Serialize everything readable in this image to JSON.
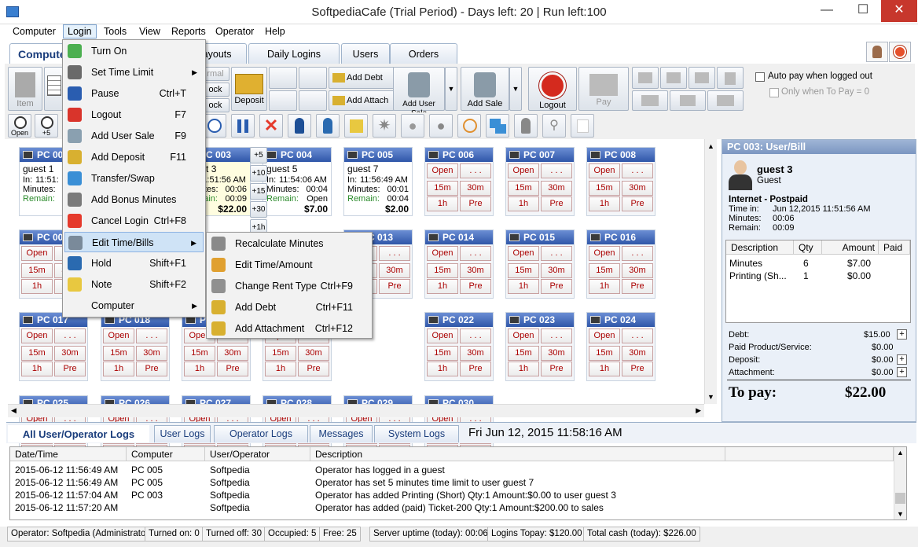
{
  "window": {
    "title": "SoftpediaCafe (Trial Period) - Days left: 20 | Run left:100",
    "minimize": "—",
    "maximize": "☐",
    "close": "✕"
  },
  "menubar": [
    "Computer",
    "Login",
    "Tools",
    "View",
    "Reports",
    "Operator",
    "Help"
  ],
  "main_tabs": [
    "Computers",
    "Debt/Payouts",
    "Daily Logins",
    "Users",
    "Orders"
  ],
  "toolbar": {
    "item": "Item",
    "deposit": "Deposit",
    "add_debt": "Add Debt",
    "add_attach": "Add Attach",
    "add_user_sale": "Add User Sale",
    "add_sale": "Add Sale",
    "logout": "Logout",
    "pay": "Pay",
    "auto_pay": "Auto pay when logged out",
    "only_when": "Only when To Pay = 0",
    "open": "Open",
    "plus5": "+5",
    "normal_partial": "rmal",
    "lock_partial": "ock"
  },
  "pcs": [
    {
      "name": "PC 001",
      "user": "guest 1",
      "in": "11:51:",
      "minutes": "",
      "remain": "",
      "amount": "$"
    },
    {
      "name": "PC 003",
      "user": "guest 3",
      "in": "11:51:56 AM",
      "minutes": "00:06",
      "remain": "00:09",
      "amount": "$22.00"
    },
    {
      "name": "PC 004",
      "user": "guest 5",
      "in": "11:54:06 AM",
      "minutes": "00:04",
      "remain": "Open",
      "amount": "$7.00"
    },
    {
      "name": "PC 005",
      "user": "guest 7",
      "in": "11:56:49 AM",
      "minutes": "00:01",
      "remain": "00:04",
      "amount": "$2.00"
    },
    {
      "name": "PC 006"
    },
    {
      "name": "PC 007"
    },
    {
      "name": "PC 008"
    },
    {
      "name": "PC 00"
    },
    {
      "name": "PC 013"
    },
    {
      "name": "PC 014"
    },
    {
      "name": "PC 015"
    },
    {
      "name": "PC 016"
    },
    {
      "name": "PC 017"
    },
    {
      "name": "PC 018"
    },
    {
      "name": "PC 0"
    },
    {
      "name": "PC 021"
    },
    {
      "name": "PC 022"
    },
    {
      "name": "PC 023"
    },
    {
      "name": "PC 024"
    },
    {
      "name": "PC 025"
    },
    {
      "name": "PC 026"
    },
    {
      "name": "PC 027"
    },
    {
      "name": "PC 028"
    },
    {
      "name": "PC 029"
    },
    {
      "name": "PC 030"
    }
  ],
  "pc_labels": {
    "in": "In:",
    "minutes": "Minutes:",
    "remain": "Remain:",
    "open": "Open",
    "dots": ". . .",
    "m15": "15m",
    "m30": "30m",
    "h1": "1h",
    "pre": "Pre"
  },
  "side_buttons": [
    "+5",
    "+10",
    "+15",
    "+30",
    "+1h"
  ],
  "right_panel": {
    "header": "PC 003: User/Bill",
    "user": "guest 3",
    "role": "Guest",
    "session": "Internet - Postpaid",
    "time_in_label": "Time in:",
    "time_in": "Jun 12,2015 11:51:56 AM",
    "minutes_label": "Minutes:",
    "minutes": "00:06",
    "remain_label": "Remain:",
    "remain": "00:09",
    "columns": [
      "Description",
      "Qty",
      "Amount",
      "Paid"
    ],
    "rows": [
      {
        "desc": "Minutes",
        "qty": "6",
        "amount": "$7.00"
      },
      {
        "desc": "Printing (Sh...",
        "qty": "1",
        "amount": "$0.00"
      }
    ],
    "debt_label": "Debt:",
    "debt": "$15.00",
    "paid_label": "Paid Product/Service:",
    "paid": "$0.00",
    "deposit_label": "Deposit:",
    "deposit": "$0.00",
    "attach_label": "Attachment:",
    "attach": "$0.00",
    "topay_label": "To pay:",
    "topay": "$22.00"
  },
  "log_tabs": [
    "All User/Operator Logs",
    "User Logs",
    "Operator Logs",
    "Messages",
    "System Logs"
  ],
  "datetime": "Fri Jun 12, 2015  11:58:16 AM",
  "log_columns": [
    "Date/Time",
    "Computer",
    "User/Operator",
    "Description"
  ],
  "logs": [
    {
      "time": "2015-06-12 11:56:49 AM",
      "pc": "PC 005",
      "user": "Softpedia",
      "desc": "Operator has logged in a guest"
    },
    {
      "time": "2015-06-12 11:56:49 AM",
      "pc": "PC 005",
      "user": "Softpedia",
      "desc": "Operator has set 5 minutes time limit to user guest 7"
    },
    {
      "time": "2015-06-12 11:57:04 AM",
      "pc": "PC 003",
      "user": "Softpedia",
      "desc": "Operator has added Printing (Short) Qty:1 Amount:$0.00 to user guest 3"
    },
    {
      "time": "2015-06-12 11:57:20 AM",
      "pc": "",
      "user": "Softpedia",
      "desc": "Operator has added (paid) Ticket-200 Qty:1 Amount:$200.00 to sales"
    }
  ],
  "status": [
    "Operator: Softpedia (Administrator)",
    "Turned on: 0",
    "Turned off: 30",
    "Occupied: 5",
    "Free: 25",
    "Server uptime (today): 00:06",
    "Logins Topay: $120.00",
    "Total cash (today): $226.00"
  ],
  "login_menu": [
    {
      "label": "Turn On",
      "sc": "",
      "sub": false,
      "color": "#4caf50"
    },
    {
      "label": "Set Time Limit",
      "sc": "",
      "sub": true,
      "color": "#6a6a6a"
    },
    {
      "label": "Pause",
      "sc": "Ctrl+T",
      "sub": false,
      "color": "#2a5db0"
    },
    {
      "label": "Logout",
      "sc": "F7",
      "sub": false,
      "color": "#d9342b"
    },
    {
      "label": "Add User Sale",
      "sc": "F9",
      "sub": false,
      "color": "#8aa0b0"
    },
    {
      "label": "Add Deposit",
      "sc": "F11",
      "sub": false,
      "color": "#d8b030"
    },
    {
      "label": "Transfer/Swap",
      "sc": "",
      "sub": false,
      "color": "#3a8fd6"
    },
    {
      "label": "Add Bonus Minutes",
      "sc": "",
      "sub": false,
      "color": "#7a7a7a"
    },
    {
      "label": "Cancel Login",
      "sc": "Ctrl+F8",
      "sub": false,
      "color": "#e53a2c"
    },
    {
      "label": "Edit Time/Bills",
      "sc": "",
      "sub": true,
      "color": "#7a8a9a"
    },
    {
      "label": "Hold",
      "sc": "Shift+F1",
      "sub": false,
      "color": "#2a6ab0"
    },
    {
      "label": "Note",
      "sc": "Shift+F2",
      "sub": false,
      "color": "#e8c840"
    },
    {
      "label": "Computer",
      "sc": "",
      "sub": true,
      "color": ""
    }
  ],
  "edit_submenu": [
    {
      "label": "Recalculate Minutes",
      "sc": "",
      "color": "#8a8a8a"
    },
    {
      "label": "Edit Time/Amount",
      "sc": "",
      "color": "#e0a030"
    },
    {
      "label": "Change Rent Type",
      "sc": "Ctrl+F9",
      "color": "#909090"
    },
    {
      "label": "Add Debt",
      "sc": "Ctrl+F11",
      "color": "#d8b030"
    },
    {
      "label": "Add Attachment",
      "sc": "Ctrl+F12",
      "color": "#d8b030"
    }
  ]
}
